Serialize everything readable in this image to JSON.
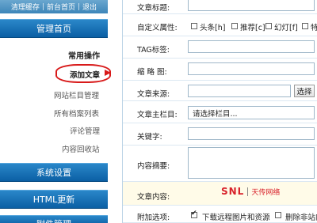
{
  "topbar": {
    "links": [
      "清理缓存",
      "前台首页",
      "退出"
    ]
  },
  "sidebar": {
    "nav_home": "管理首页",
    "section_title": "常用操作",
    "sub_items": [
      "添加文章",
      "网站栏目管理",
      "所有档案列表",
      "评论管理",
      "内容回收站"
    ],
    "nav_system": "系统设置",
    "nav_html": "HTML更新",
    "nav_last": "附件管理"
  },
  "form": {
    "title_label": "文章标题:",
    "custom_attr_label": "自定义属性:",
    "attrs": [
      "头条[h]",
      "推荐[c]",
      "幻灯[f]",
      "特"
    ],
    "tag_label": "TAG标签:",
    "thumb_label": "缩 略 图:",
    "source_label": "文章来源:",
    "select_button": "选择",
    "main_column_label": "文章主栏目:",
    "main_column_value": "请选择栏目...",
    "keywords_label": "关键字:",
    "summary_label": "内容摘要:",
    "content_label": "文章内容:",
    "extra_options_label": "附加选项:",
    "extra_options": [
      "下载远程图片和资源",
      "删除非站内"
    ]
  },
  "logo": {
    "brand": "SNL",
    "name": "天传网络"
  },
  "colors": {
    "nav_blue": "#0b5fa4",
    "highlight_red": "#d81a1a",
    "logo_red": "#d8202a"
  }
}
